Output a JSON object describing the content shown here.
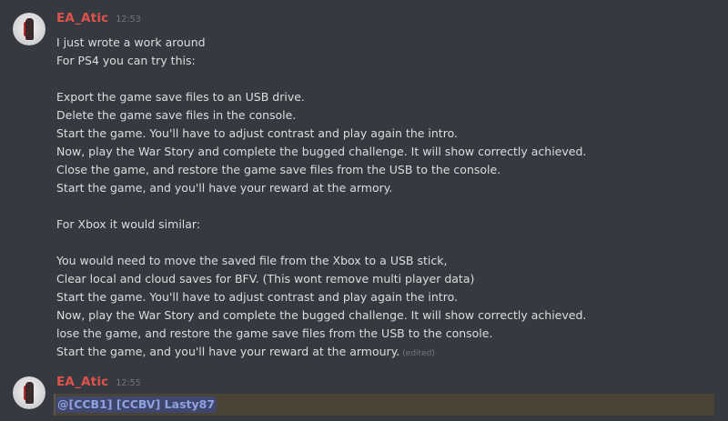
{
  "messages": [
    {
      "author": "EA_Atic",
      "time": "12:53",
      "lines": [
        "I just wrote a work around",
        "For PS4 you can try this:",
        "",
        "Export the game save files to an USB drive.",
        "Delete the game save files in the console.",
        "Start the game. You'll have to adjust contrast and play again the intro.",
        "Now, play the War Story and complete the bugged challenge. It will show correctly achieved.",
        "Close the game, and restore the game save files from the USB to the console.",
        "Start the game, and you'll have your reward at the armory.",
        "",
        "For Xbox it would similar:",
        "",
        "You would need to move the saved file from the Xbox to a USB stick,",
        "Clear local and cloud saves for BFV. (This wont remove multi player data)",
        "Start the game. You'll have to adjust contrast and play again the intro.",
        "Now, play the War Story and complete the bugged challenge. It will show correctly achieved.",
        "lose the game, and restore the game save files from the USB to the console.",
        "Start the game, and you'll have your reward at the armoury."
      ],
      "edited_label": "(edited)"
    },
    {
      "author": "EA_Atic",
      "time": "12:55",
      "mention": "@[CCB1] [CCBV] Lasty87"
    }
  ],
  "colors": {
    "background": "#36393f",
    "username": "#e0534b",
    "text": "#dcddde",
    "timestamp": "#72767d",
    "mention_text": "#8ea1e1",
    "mention_bg": "#41476c",
    "highlight_bg": "#4b4335"
  }
}
